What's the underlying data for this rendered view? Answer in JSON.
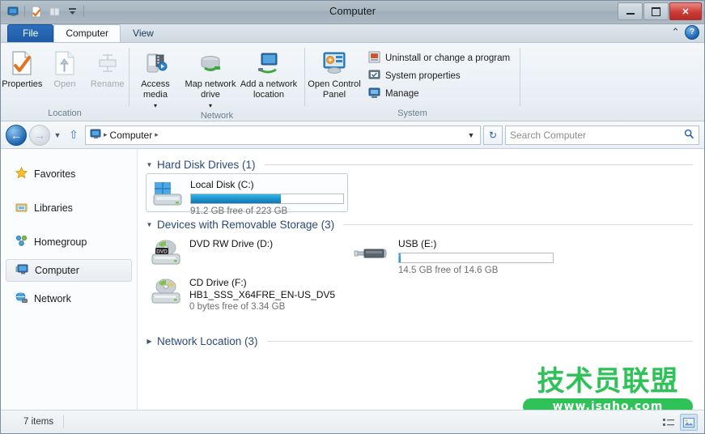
{
  "window": {
    "title": "Computer",
    "quick_access": [
      {
        "name": "computer-icon",
        "glyph": "🖥"
      },
      {
        "name": "properties-icon",
        "glyph": "📄"
      },
      {
        "name": "new-folder-icon",
        "glyph": "🗂"
      },
      {
        "name": "customize-dropdown-icon",
        "glyph": "▼"
      }
    ],
    "controls": {
      "minimize": "Minimize",
      "maximize": "Maximize",
      "close": "✕"
    }
  },
  "tabs": [
    {
      "label": "File",
      "type": "file"
    },
    {
      "label": "Computer",
      "type": "active"
    },
    {
      "label": "View",
      "type": "normal"
    }
  ],
  "ribbon_right": {
    "collapse_label": "⌃",
    "help_label": "?"
  },
  "ribbon": {
    "groups": [
      {
        "title": "Location",
        "buttons": [
          {
            "label": "Properties",
            "icon": "properties-icon",
            "enabled": true,
            "caret": false
          },
          {
            "label": "Open",
            "icon": "open-icon",
            "enabled": false,
            "caret": false
          },
          {
            "label": "Rename",
            "icon": "rename-icon",
            "enabled": false,
            "caret": false
          }
        ]
      },
      {
        "title": "Network",
        "buttons": [
          {
            "label": "Access media",
            "icon": "access-media-icon",
            "enabled": true,
            "caret": true
          },
          {
            "label": "Map network drive",
            "icon": "map-network-drive-icon",
            "enabled": true,
            "caret": true
          },
          {
            "label": "Add a network location",
            "icon": "add-network-location-icon",
            "enabled": true,
            "caret": false
          }
        ]
      },
      {
        "title": "System",
        "big": {
          "label": "Open Control Panel",
          "icon": "control-panel-icon"
        },
        "small": [
          {
            "label": "Uninstall or change a program",
            "icon": "uninstall-program-icon"
          },
          {
            "label": "System properties",
            "icon": "system-properties-icon"
          },
          {
            "label": "Manage",
            "icon": "manage-icon"
          }
        ]
      }
    ]
  },
  "addressbar": {
    "back_glyph": "←",
    "forward_glyph": "→",
    "history_caret": "▼",
    "up_glyph": "⇧",
    "breadcrumb": [
      {
        "label": "Computer"
      }
    ],
    "breadcrumb_sep": "▸",
    "breadcrumb_dropdown": "▼",
    "refresh_glyph": "↻",
    "search_placeholder": "Search Computer",
    "search_value": "",
    "search_icon": "🔍"
  },
  "sidebar": {
    "items": [
      {
        "label": "Favorites",
        "icon": "star-icon",
        "selected": false
      },
      {
        "label": "Libraries",
        "icon": "libraries-icon",
        "selected": false
      },
      {
        "label": "Homegroup",
        "icon": "homegroup-icon",
        "selected": false
      },
      {
        "label": "Computer",
        "icon": "computer-icon",
        "selected": true
      },
      {
        "label": "Network",
        "icon": "network-icon",
        "selected": false
      }
    ]
  },
  "main": {
    "sections": [
      {
        "title": "Hard Disk Drives (1)",
        "expanded": true,
        "tiles": [
          {
            "name": "Local Disk (C:)",
            "icon": "hard-drive-icon",
            "capacity_text": "91.2 GB free of 223 GB",
            "free_gb": 91.2,
            "total_gb": 223,
            "used_percent": 59,
            "has_bar": true,
            "selected": true
          }
        ]
      },
      {
        "title": "Devices with Removable Storage (3)",
        "expanded": true,
        "tiles": [
          {
            "name": "DVD RW Drive (D:)",
            "icon": "dvd-drive-icon",
            "capacity_text": "",
            "has_bar": false,
            "selected": false
          },
          {
            "name": "USB (E:)",
            "icon": "usb-drive-icon",
            "capacity_text": "14.5 GB free of 14.6 GB",
            "free_gb": 14.5,
            "total_gb": 14.6,
            "used_percent": 1,
            "has_bar": true,
            "selected": false
          },
          {
            "name": "CD Drive (F:)",
            "label2": "HB1_SSS_X64FRE_EN-US_DV5",
            "icon": "cd-drive-icon",
            "capacity_text": "0 bytes free of 3.34 GB",
            "free_gb": 0,
            "total_gb": 3.34,
            "used_percent": 100,
            "has_bar": false,
            "selected": false
          }
        ]
      },
      {
        "title": "Network Location (3)",
        "expanded": false,
        "tiles": []
      }
    ]
  },
  "watermark": {
    "title": "技术员联盟",
    "url": "www.jsgho.com",
    "color": "#2fc258"
  },
  "statusbar": {
    "item_count": "7 items",
    "view_details_icon": "details-view-icon",
    "view_large_icon": "large-icons-view-icon"
  },
  "colors": {
    "accent_blue": "#1f95cc",
    "section_heading": "#2b4a78",
    "file_tab": "#2c6fbd",
    "close_button": "#cf3b36"
  }
}
